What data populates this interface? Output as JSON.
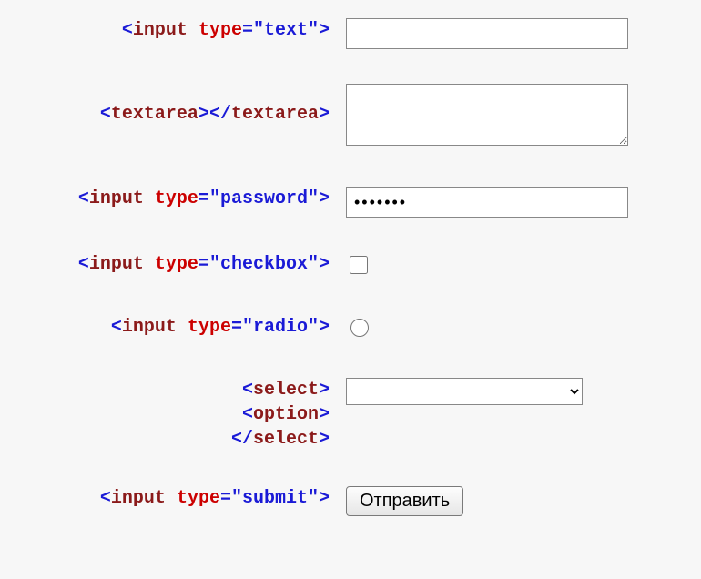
{
  "rows": {
    "text_input": {
      "open": "<",
      "tag": "input",
      "sp": " ",
      "attr": "type",
      "eq": "=",
      "val": "\"text\"",
      "close": ">"
    },
    "textarea": {
      "open1": "<",
      "tag1": "textarea",
      "close1": ">",
      "open2": "</",
      "tag2": "textarea",
      "close2": ">"
    },
    "password": {
      "open": "<",
      "tag": "input",
      "sp": " ",
      "attr": "type",
      "eq": "=",
      "val": "\"password\"",
      "close": ">",
      "value": "•••••••"
    },
    "checkbox": {
      "open": "<",
      "tag": "input",
      "sp": " ",
      "attr": "type",
      "eq": "=",
      "val": "\"checkbox\"",
      "close": ">"
    },
    "radio": {
      "open": "<",
      "tag": "input",
      "sp": " ",
      "attr": "type",
      "eq": "=",
      "val": "\"radio\"",
      "close": ">"
    },
    "select": {
      "l1_open": "<",
      "l1_tag": "select",
      "l1_close": ">",
      "l2_open": "<",
      "l2_tag": "option",
      "l2_close": ">",
      "l3_open": "</",
      "l3_tag": "select",
      "l3_close": ">",
      "selected_option": ""
    },
    "submit": {
      "open": "<",
      "tag": "input",
      "sp": " ",
      "attr": "type",
      "eq": "=",
      "val": "\"submit\"",
      "close": ">",
      "button_label": "Отправить"
    }
  }
}
